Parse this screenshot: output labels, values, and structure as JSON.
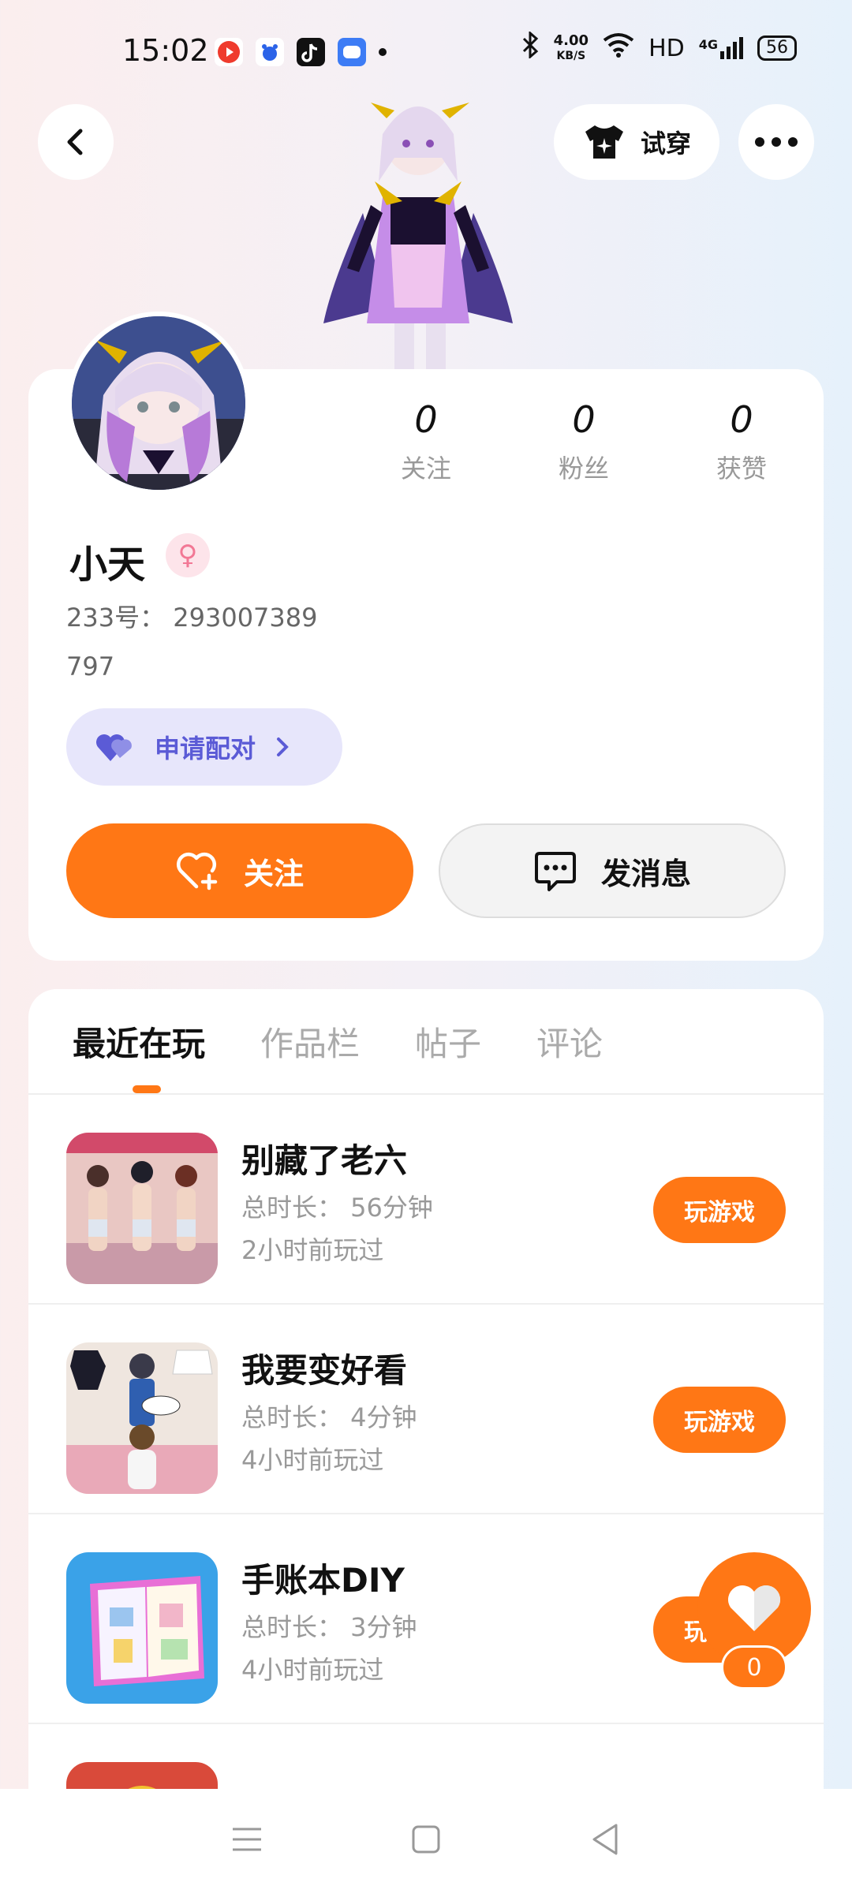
{
  "status_bar": {
    "time": "15:02",
    "network_speed_value": "4.00",
    "network_speed_unit": "KB/S",
    "hd_label": "HD",
    "signal_label": "4G",
    "battery": "56"
  },
  "header": {
    "try_on_label": "试穿"
  },
  "profile": {
    "name": "小天",
    "uid": "233号： 293007389",
    "extra": "797",
    "stats": [
      {
        "value": "0",
        "label": "关注"
      },
      {
        "value": "0",
        "label": "粉丝"
      },
      {
        "value": "0",
        "label": "获赞"
      }
    ],
    "pair_label": "申请配对",
    "follow_label": "关注",
    "message_label": "发消息"
  },
  "tabs": [
    {
      "label": "最近在玩"
    },
    {
      "label": "作品栏"
    },
    {
      "label": "帖子"
    },
    {
      "label": "评论"
    }
  ],
  "games": [
    {
      "title": "别藏了老六",
      "duration": "总时长： 56分钟",
      "last_played": "2小时前玩过",
      "action": "玩游戏"
    },
    {
      "title": "我要变好看",
      "duration": "总时长： 4分钟",
      "last_played": "4小时前玩过",
      "action": "玩游戏"
    },
    {
      "title": "手账本DIY",
      "duration": "总时长： 3分钟",
      "last_played": "4小时前玩过",
      "action": "玩游戏"
    },
    {
      "title": "",
      "duration": "",
      "last_played": "",
      "action": ""
    }
  ],
  "fab": {
    "count": "0"
  },
  "colors": {
    "accent": "#ff7715",
    "pair": "#5b5bd6"
  }
}
